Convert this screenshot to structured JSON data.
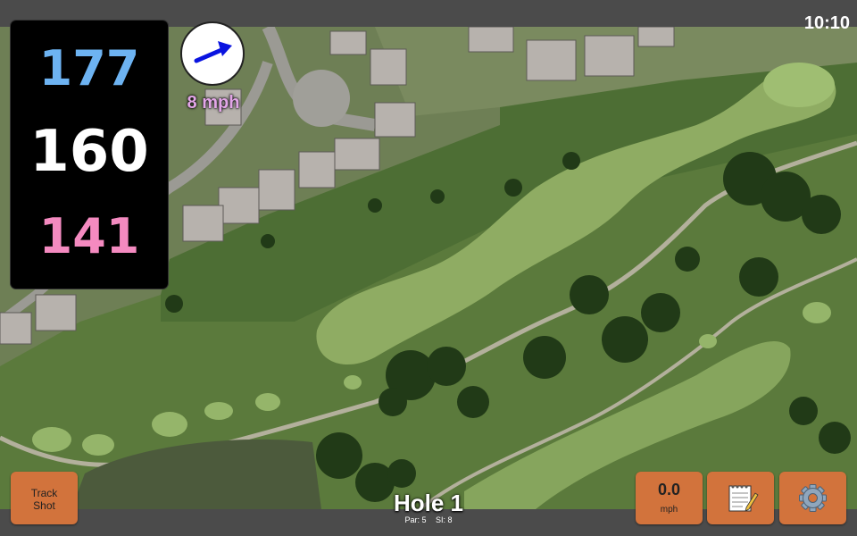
{
  "status": {
    "time": "10:10"
  },
  "distances": {
    "back": "177",
    "middle": "160",
    "front": "141"
  },
  "wind": {
    "speed_label": "8 mph",
    "direction_icon": "arrow-icon",
    "arrow_color": "#0a14e0",
    "label_color": "#e3a6e8"
  },
  "hole": {
    "title": "Hole 1",
    "par": "Par: 5",
    "si": "SI: 8"
  },
  "buttons": {
    "track_shot_line1": "Track",
    "track_shot_line2": "Shot",
    "wind_value": "0.0",
    "wind_unit": "mph",
    "notes_icon": "notepad-icon",
    "settings_icon": "gear-icon",
    "accent": "#d2733c"
  },
  "colors": {
    "back_distance": "#6db3f2",
    "middle_distance": "#ffffff",
    "front_distance": "#f48ac0"
  }
}
